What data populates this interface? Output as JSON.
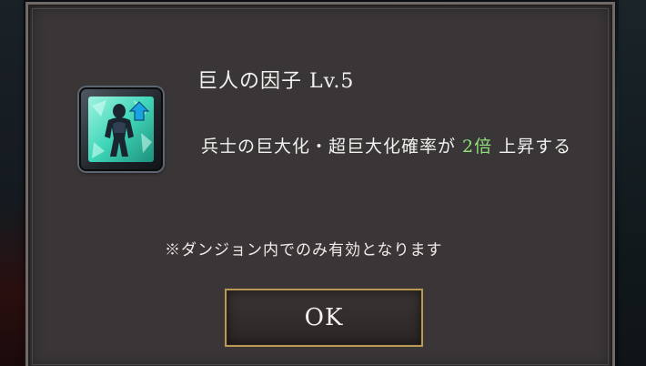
{
  "dialog": {
    "title": "巨人の因子 Lv.5",
    "description": {
      "before": "兵士の巨大化・超巨大化確率が ",
      "highlight": "2倍",
      "after": " 上昇する"
    },
    "note": "※ダンジョン内でのみ有効となります",
    "ok_label": "OK",
    "item_icon": "giant-factor-icon",
    "colors": {
      "panel": "#3a3637",
      "highlight": "#8fe07a",
      "button_border": "#b99a55",
      "icon_bg": "#3fd6b8"
    }
  }
}
